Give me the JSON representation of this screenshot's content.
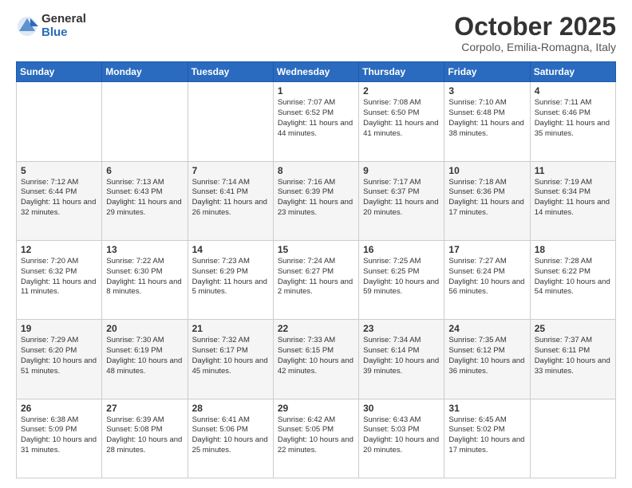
{
  "logo": {
    "general": "General",
    "blue": "Blue"
  },
  "header": {
    "month": "October 2025",
    "location": "Corpolo, Emilia-Romagna, Italy"
  },
  "weekdays": [
    "Sunday",
    "Monday",
    "Tuesday",
    "Wednesday",
    "Thursday",
    "Friday",
    "Saturday"
  ],
  "weeks": [
    [
      {
        "day": "",
        "text": ""
      },
      {
        "day": "",
        "text": ""
      },
      {
        "day": "",
        "text": ""
      },
      {
        "day": "1",
        "text": "Sunrise: 7:07 AM\nSunset: 6:52 PM\nDaylight: 11 hours and 44 minutes."
      },
      {
        "day": "2",
        "text": "Sunrise: 7:08 AM\nSunset: 6:50 PM\nDaylight: 11 hours and 41 minutes."
      },
      {
        "day": "3",
        "text": "Sunrise: 7:10 AM\nSunset: 6:48 PM\nDaylight: 11 hours and 38 minutes."
      },
      {
        "day": "4",
        "text": "Sunrise: 7:11 AM\nSunset: 6:46 PM\nDaylight: 11 hours and 35 minutes."
      }
    ],
    [
      {
        "day": "5",
        "text": "Sunrise: 7:12 AM\nSunset: 6:44 PM\nDaylight: 11 hours and 32 minutes."
      },
      {
        "day": "6",
        "text": "Sunrise: 7:13 AM\nSunset: 6:43 PM\nDaylight: 11 hours and 29 minutes."
      },
      {
        "day": "7",
        "text": "Sunrise: 7:14 AM\nSunset: 6:41 PM\nDaylight: 11 hours and 26 minutes."
      },
      {
        "day": "8",
        "text": "Sunrise: 7:16 AM\nSunset: 6:39 PM\nDaylight: 11 hours and 23 minutes."
      },
      {
        "day": "9",
        "text": "Sunrise: 7:17 AM\nSunset: 6:37 PM\nDaylight: 11 hours and 20 minutes."
      },
      {
        "day": "10",
        "text": "Sunrise: 7:18 AM\nSunset: 6:36 PM\nDaylight: 11 hours and 17 minutes."
      },
      {
        "day": "11",
        "text": "Sunrise: 7:19 AM\nSunset: 6:34 PM\nDaylight: 11 hours and 14 minutes."
      }
    ],
    [
      {
        "day": "12",
        "text": "Sunrise: 7:20 AM\nSunset: 6:32 PM\nDaylight: 11 hours and 11 minutes."
      },
      {
        "day": "13",
        "text": "Sunrise: 7:22 AM\nSunset: 6:30 PM\nDaylight: 11 hours and 8 minutes."
      },
      {
        "day": "14",
        "text": "Sunrise: 7:23 AM\nSunset: 6:29 PM\nDaylight: 11 hours and 5 minutes."
      },
      {
        "day": "15",
        "text": "Sunrise: 7:24 AM\nSunset: 6:27 PM\nDaylight: 11 hours and 2 minutes."
      },
      {
        "day": "16",
        "text": "Sunrise: 7:25 AM\nSunset: 6:25 PM\nDaylight: 10 hours and 59 minutes."
      },
      {
        "day": "17",
        "text": "Sunrise: 7:27 AM\nSunset: 6:24 PM\nDaylight: 10 hours and 56 minutes."
      },
      {
        "day": "18",
        "text": "Sunrise: 7:28 AM\nSunset: 6:22 PM\nDaylight: 10 hours and 54 minutes."
      }
    ],
    [
      {
        "day": "19",
        "text": "Sunrise: 7:29 AM\nSunset: 6:20 PM\nDaylight: 10 hours and 51 minutes."
      },
      {
        "day": "20",
        "text": "Sunrise: 7:30 AM\nSunset: 6:19 PM\nDaylight: 10 hours and 48 minutes."
      },
      {
        "day": "21",
        "text": "Sunrise: 7:32 AM\nSunset: 6:17 PM\nDaylight: 10 hours and 45 minutes."
      },
      {
        "day": "22",
        "text": "Sunrise: 7:33 AM\nSunset: 6:15 PM\nDaylight: 10 hours and 42 minutes."
      },
      {
        "day": "23",
        "text": "Sunrise: 7:34 AM\nSunset: 6:14 PM\nDaylight: 10 hours and 39 minutes."
      },
      {
        "day": "24",
        "text": "Sunrise: 7:35 AM\nSunset: 6:12 PM\nDaylight: 10 hours and 36 minutes."
      },
      {
        "day": "25",
        "text": "Sunrise: 7:37 AM\nSunset: 6:11 PM\nDaylight: 10 hours and 33 minutes."
      }
    ],
    [
      {
        "day": "26",
        "text": "Sunrise: 6:38 AM\nSunset: 5:09 PM\nDaylight: 10 hours and 31 minutes."
      },
      {
        "day": "27",
        "text": "Sunrise: 6:39 AM\nSunset: 5:08 PM\nDaylight: 10 hours and 28 minutes."
      },
      {
        "day": "28",
        "text": "Sunrise: 6:41 AM\nSunset: 5:06 PM\nDaylight: 10 hours and 25 minutes."
      },
      {
        "day": "29",
        "text": "Sunrise: 6:42 AM\nSunset: 5:05 PM\nDaylight: 10 hours and 22 minutes."
      },
      {
        "day": "30",
        "text": "Sunrise: 6:43 AM\nSunset: 5:03 PM\nDaylight: 10 hours and 20 minutes."
      },
      {
        "day": "31",
        "text": "Sunrise: 6:45 AM\nSunset: 5:02 PM\nDaylight: 10 hours and 17 minutes."
      },
      {
        "day": "",
        "text": ""
      }
    ]
  ]
}
